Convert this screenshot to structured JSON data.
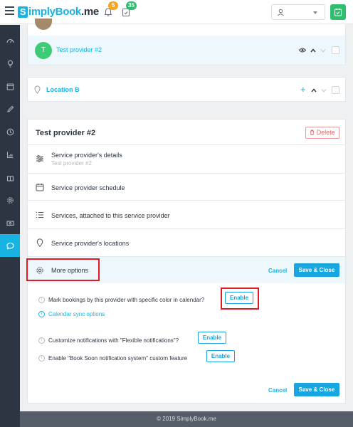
{
  "header": {
    "logo_initial": "S",
    "logo_text": "implyBook",
    "logo_suffix": ".me",
    "notifications_count": "5",
    "tasks_count": "35"
  },
  "provider_list": {
    "avatar_initial": "T",
    "provider_name": "Test provider #2",
    "location_name": "Location B"
  },
  "panel": {
    "title": "Test provider #2",
    "delete_label": "Delete",
    "menu": [
      {
        "label": "Service provider's details",
        "sub": "Test provider #2"
      },
      {
        "label": "Service provider schedule"
      },
      {
        "label": "Services, attached to this service provider"
      },
      {
        "label": "Service provider's locations"
      },
      {
        "label": "More options"
      }
    ],
    "cancel_label": "Cancel",
    "save_label": "Save & Close",
    "options": {
      "color_text": "Mark bookings by this provider with specific color in calendar?",
      "enable_label": "Enable",
      "calendar_sync_label": "Calendar sync options",
      "flexible_text": "Customize notifications with \"Flexible notifications\"?",
      "book_soon_text": "Enable \"Book Soon notification system\" custom feature"
    }
  },
  "footer": {
    "copyright": "© 2019 SimplyBook.me"
  },
  "colors": {
    "accent": "#17b3e3",
    "sidebar": "#2c3542",
    "success": "#2fbd6e",
    "highlight": "#e01b24"
  }
}
